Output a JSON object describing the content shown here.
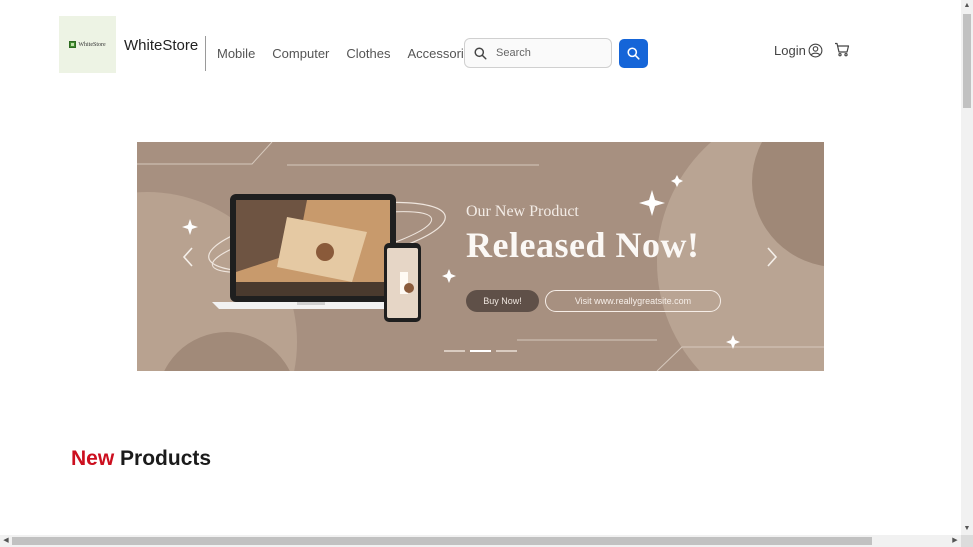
{
  "header": {
    "logo_text": "WhiteStore",
    "brand": "WhiteStore",
    "nav": [
      "Mobile",
      "Computer",
      "Clothes",
      "Accessories"
    ],
    "search": {
      "placeholder": "Search",
      "value": ""
    },
    "login_label": "Login",
    "icons": {
      "search": "search-icon",
      "user": "user-circle-icon",
      "cart": "cart-icon"
    }
  },
  "banner": {
    "subtitle": "Our New Product",
    "title": "Released Now!",
    "buy_label": "Buy Now!",
    "visit_label": "Visit www.reallygreatsite.com",
    "slides": 3,
    "active_slide": 2
  },
  "section": {
    "title_accent": "New",
    "title_rest": "Products"
  },
  "colors": {
    "accent_red": "#cc0f1f",
    "primary_blue": "#1565d8",
    "banner_bg": "#a79080"
  }
}
